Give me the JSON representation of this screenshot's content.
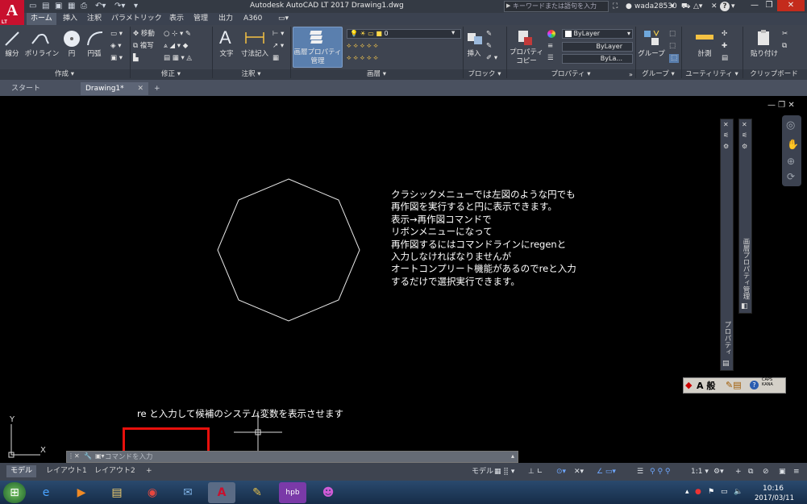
{
  "window": {
    "title": "Autodesk AutoCAD LT 2017    Drawing1.dwg",
    "search_placeholder": "キーワードまたは語句を入力",
    "username": "wada28530",
    "help": "?"
  },
  "app_logo": {
    "letter": "A",
    "sub": "LT"
  },
  "ribbon_tabs": [
    "ホーム",
    "挿入",
    "注釈",
    "パラメトリック",
    "表示",
    "管理",
    "出力",
    "A360"
  ],
  "ribbon": {
    "draw": {
      "line": "線分",
      "polyline": "ポリライン",
      "circle": "円",
      "arc": "円弧"
    },
    "modify": {
      "move": "移動",
      "copy": "複写"
    },
    "annotation": {
      "text": "文字",
      "dimension": "寸法記入"
    },
    "layers": {
      "layer_props_1": "画層プロパティ",
      "layer_props_2": "管理",
      "current_layer": "0"
    },
    "block": {
      "insert": "挿入"
    },
    "properties": {
      "match_1": "プロパティ",
      "match_2": "コピー",
      "bylayer_1": "ByLayer",
      "bylayer_2": "ByLayer",
      "bylayer_3": "ByLa..."
    },
    "group": {
      "group": "グループ"
    },
    "utilities": {
      "measure": "計測"
    },
    "clipboard": {
      "paste": "貼り付け"
    }
  },
  "panel_titles": {
    "draw": "作成 ▾",
    "modify": "修正 ▾",
    "annotation": "注釈 ▾",
    "layers": "画層 ▾",
    "block": "ブロック ▾",
    "properties": "プロパティ ▾",
    "group": "グループ ▾",
    "utilities": "ユーティリティ ▾",
    "clipboard": "クリップボード"
  },
  "doc_tabs": {
    "start": "スタート",
    "drawing": "Drawing1*"
  },
  "annotation_lines": "クラシックメニューでは左図のような円でも\n再作図を実行すると円に表示できます。\n表示→再作図コマンドで\nリボンメニューになって\n再作図するにはコマンドラインにregenと\n入力しなければなりませんが\nオートコンプリート機能があるのでreと入力\nするだけで選択実行できます。",
  "caption": "re と入力して候補のシステム変数を表示させます",
  "ucs": {
    "x": "X",
    "y": "Y"
  },
  "palettes": {
    "properties": "プロパティ",
    "layer_props": "画層プロパティ管理"
  },
  "command_line": {
    "placeholder": "コマンドを入力"
  },
  "layout_tabs": [
    "モデル",
    "レイアウト1",
    "レイアウト2"
  ],
  "status": {
    "model": "モデル",
    "scale": "1:1 ▾"
  },
  "ime_bar": {
    "mode": "A 般",
    "caps": "CAPS\nKANA"
  },
  "taskbar": {
    "time": "10:16",
    "date": "2017/03/11"
  },
  "colors": {
    "accent": "#c8102e",
    "ribbon": "#3e4450",
    "canvas": "#000000",
    "highlight": "#e8100c"
  }
}
